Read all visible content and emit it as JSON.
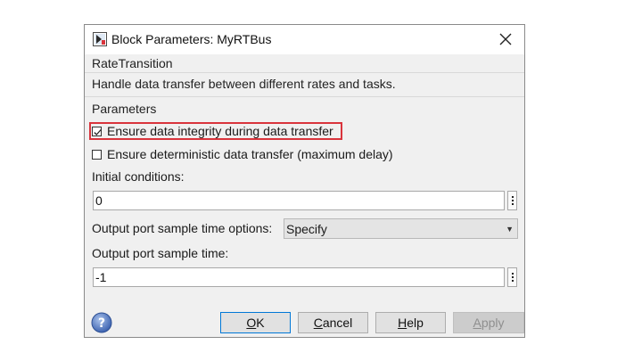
{
  "window": {
    "title": "Block Parameters: MyRTBus"
  },
  "block": {
    "type_label": "RateTransition",
    "description": "Handle data transfer between different rates and tasks."
  },
  "parameters": {
    "label": "Parameters",
    "ensure_integrity": {
      "label": "Ensure data integrity during data transfer",
      "checked": true
    },
    "ensure_deterministic": {
      "label": "Ensure deterministic data transfer (maximum delay)",
      "checked": false
    },
    "initial_conditions": {
      "label": "Initial conditions:",
      "value": "0"
    },
    "sample_time_options": {
      "label": "Output port sample time options:",
      "selected": "Specify"
    },
    "sample_time": {
      "label": "Output port sample time:",
      "value": "-1"
    }
  },
  "buttons": {
    "ok": "OK",
    "cancel": "Cancel",
    "help": "Help",
    "apply": "Apply"
  },
  "colors": {
    "highlight": "#d9343c",
    "primary_border": "#0078d7",
    "help_icon": "#5a7fc0"
  }
}
